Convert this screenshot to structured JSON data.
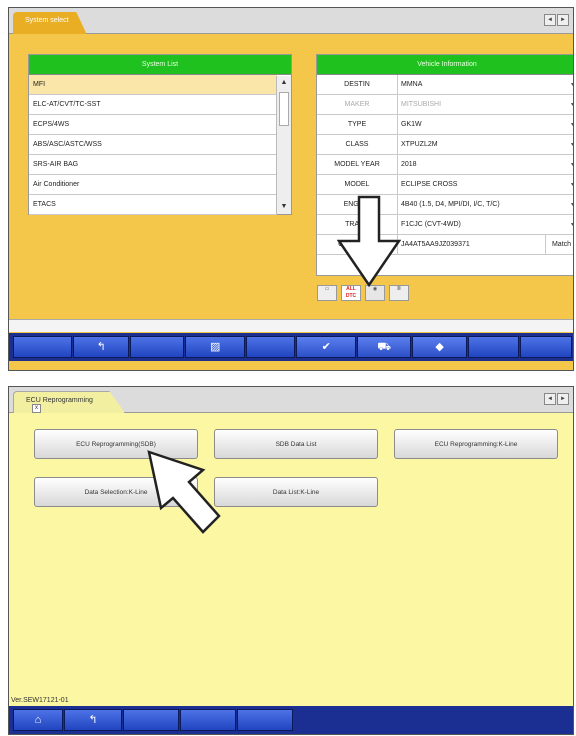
{
  "screen1": {
    "tab_title": "System select",
    "nav": {
      "prev": "◄",
      "next": "►"
    },
    "system_list": {
      "header": "System List",
      "items": [
        "MFI",
        "ELC-AT/CVT/TC-SST",
        "ECPS/4WS",
        "ABS/ASC/ASTC/WSS",
        "SRS-AIR BAG",
        "Air Conditioner",
        "ETACS"
      ],
      "selected": "MFI"
    },
    "vehicle_info": {
      "header": "Vehicle Information",
      "rows": [
        {
          "label": "DESTIN",
          "value": "MMNA"
        },
        {
          "label": "MAKER",
          "value": "MITSUBISHI"
        },
        {
          "label": "TYPE",
          "value": "GK1W"
        },
        {
          "label": "CLASS",
          "value": "XTPUZL2M"
        },
        {
          "label": "MODEL YEAR",
          "value": "2018"
        },
        {
          "label": "MODEL",
          "value": "ECLIPSE CROSS"
        },
        {
          "label": "ENGINE",
          "value": "4B40 (1.5, D4, MPI/DI, I/C, T/C)"
        },
        {
          "label": "TRANS",
          "value": "F1CJC (CVT-4WD)"
        },
        {
          "label": "Chassis No.",
          "value": "JA4AT5AA9JZ039371",
          "button": "Match"
        }
      ]
    },
    "icons": [
      {
        "name": "vehicle-data-icon",
        "label": ""
      },
      {
        "name": "all-dtc-icon",
        "label": "ALL DTC"
      },
      {
        "name": "ecu-reprogramming-icon",
        "label": ""
      },
      {
        "name": "settings-list-icon",
        "label": ""
      }
    ]
  },
  "screen2": {
    "tab_title": "ECU Reprogramming",
    "buttons": {
      "ecu_sdb": "ECU Reprogramming(SDB)",
      "sdb_data_list": "SDB Data List",
      "ecu_kline": "ECU Reprogramming:K-Line",
      "data_selection_kline": "Data Selection:K-Line",
      "data_list_kline": "Data List:K-Line"
    },
    "version": "Ver.SEW17121-01"
  },
  "colors": {
    "screen1_bg": "#f4c74a",
    "screen2_bg": "#fbf7a3",
    "panel_header": "#1fc11f",
    "button_bar": "#1c2f8e"
  }
}
